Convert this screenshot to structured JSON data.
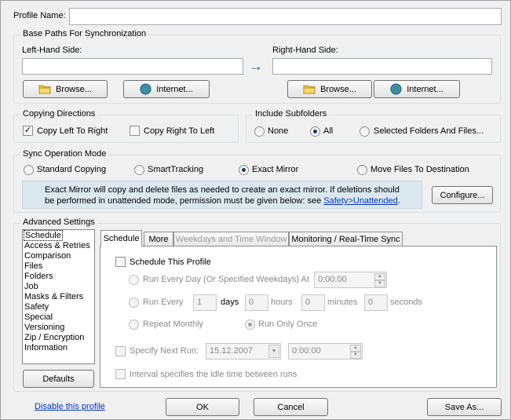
{
  "profile": {
    "name_label": "Profile Name:",
    "name_value": ""
  },
  "base_paths": {
    "title": "Base Paths For Synchronization",
    "left_label": "Left-Hand Side:",
    "right_label": "Right-Hand Side:",
    "left_value": "",
    "right_value": "",
    "browse_label": "Browse...",
    "internet_label": "Internet...",
    "arrow": "→"
  },
  "copying_directions": {
    "title": "Copying Directions",
    "left_to_right": "Copy Left To Right",
    "left_to_right_checked": "✓",
    "right_to_left": "Copy Right To Left"
  },
  "include_subfolders": {
    "title": "Include Subfolders",
    "none": "None",
    "all": "All",
    "selected": "Selected Folders And Files..."
  },
  "sync_mode": {
    "title": "Sync Operation Mode",
    "standard": "Standard Copying",
    "smart": "SmartTracking",
    "exact": "Exact Mirror",
    "move": "Move Files To Destination",
    "info_line1": "Exact Mirror will copy and delete files as needed to create an exact mirror. If deletions should",
    "info_line2": "be performed in unattended mode, permission must be given below: see ",
    "info_link": "Safety>Unattended",
    "info_end": ".",
    "configure_label": "Configure..."
  },
  "advanced": {
    "title": "Advanced Settings",
    "list": [
      "Schedule",
      "Access & Retries",
      "Comparison",
      "Files",
      "Folders",
      "Job",
      "Masks & Filters",
      "Safety",
      "Special",
      "Versioning",
      "Zip / Encryption",
      "Information"
    ],
    "defaults_label": "Defaults",
    "tabs": [
      "Schedule",
      "More",
      "Weekdays and Time Window",
      "Monitoring / Real-Time Sync"
    ]
  },
  "schedule": {
    "schedule_this_profile": "Schedule This Profile",
    "run_every_day": "Run Every Day (Or Specified Weekdays) At",
    "run_every_day_time": "0:00:00",
    "run_every": "Run Every",
    "days_value": "1",
    "days_label": "days",
    "hours_value": "0",
    "hours_label": "hours",
    "minutes_value": "0",
    "minutes_label": "minutes",
    "seconds_value": "0",
    "seconds_label": "seconds",
    "repeat_monthly": "Repeat Monthly",
    "run_only_once": "Run Only Once",
    "specify_next_run": "Specify Next Run:",
    "next_run_date": "15.12.2007",
    "next_run_time": "0:00:00",
    "interval_idle": "Interval specifies the idle time between runs"
  },
  "footer": {
    "disable_link": "Disable this profile",
    "ok_label": "OK",
    "cancel_label": "Cancel",
    "save_as_label": "Save As..."
  },
  "colors": {
    "window_bg": "#f0f0f0",
    "info_bg": "#dce8f0",
    "link": "#0033cc",
    "arrow": "#1f6fb8"
  }
}
